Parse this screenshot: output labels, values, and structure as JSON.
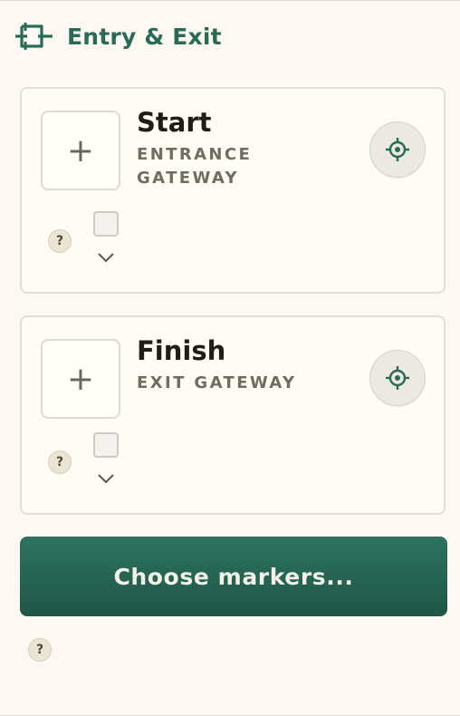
{
  "header": {
    "title": "Entry & Exit",
    "icon": "entry-exit-icon"
  },
  "start": {
    "add_label": "+",
    "title": "Start",
    "subtitle": "ENTRANCE GATEWAY",
    "help": "?",
    "checked": false
  },
  "finish": {
    "add_label": "+",
    "title": "Finish",
    "subtitle": "EXIT GATEWAY",
    "help": "?",
    "checked": false
  },
  "primary_button": {
    "label": "Choose markers..."
  },
  "footer": {
    "help": "?"
  },
  "colors": {
    "accent": "#2a6b58",
    "button": "#266453",
    "background": "#fdf9f2"
  }
}
